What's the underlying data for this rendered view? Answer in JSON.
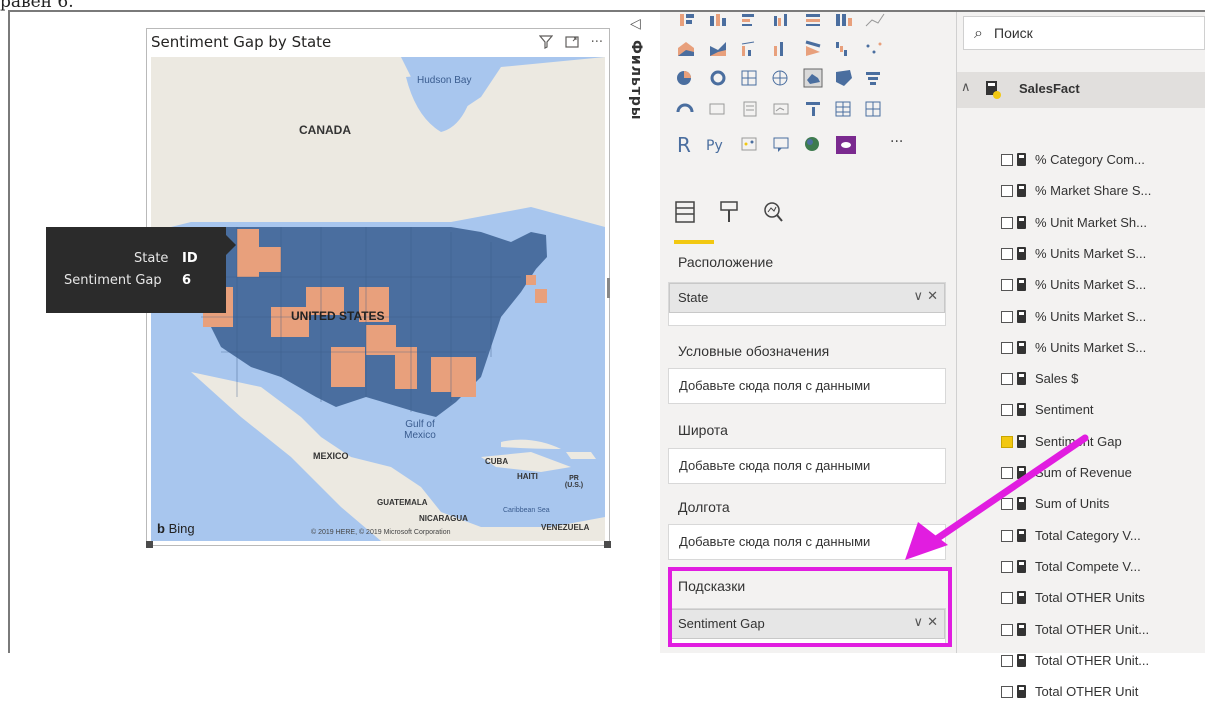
{
  "top_text": "равен 6.",
  "visual": {
    "title": "Sentiment Gap by State",
    "filter_icon": "funnel-icon",
    "focus_icon": "focus-mode-icon",
    "more_icon": "ellipsis-icon",
    "map_labels": {
      "hudson_bay": "Hudson Bay",
      "canada": "CANADA",
      "united_states": "UNITED STATES",
      "gulf": "Gulf of Mexico",
      "mexico": "MEXICO",
      "cuba": "CUBA",
      "haiti": "HAITI",
      "pr": "PR (U.S.)",
      "guatemala": "GUATEMALA",
      "nicaragua": "NICARAGUA",
      "caribbean": "Caribbean Sea",
      "venezuela": "VENEZUELA",
      "bing": "Bing",
      "copyright": "© 2019 HERE, © 2019 Microsoft Corporation"
    },
    "colors": {
      "high": "#4a6e9f",
      "low": "#e8a07c",
      "water": "#a8c6ee",
      "land": "#ece9e1"
    }
  },
  "tooltip": {
    "state_label": "State",
    "state_value": "ID",
    "gap_label": "Sentiment Gap",
    "gap_value": "6"
  },
  "filters_pane": {
    "collapse_icon": "chevron-left-icon",
    "label": "Фильтры"
  },
  "viz_pane": {
    "tabs": [
      "fields-icon",
      "format-paint-icon",
      "analytics-icon"
    ],
    "sections": {
      "location_label": "Расположение",
      "location_value": "State",
      "legend_label": "Условные обозначения",
      "legend_placeholder": "Добавьте сюда поля с данными",
      "lat_label": "Широта",
      "lat_placeholder": "Добавьте сюда поля с данными",
      "lon_label": "Долгота",
      "lon_placeholder": "Добавьте сюда поля с данными",
      "tooltips_label": "Подсказки",
      "tooltips_value": "Sentiment Gap"
    },
    "pill_controls": "∨ ✕",
    "more_visuals": "···"
  },
  "fields_pane": {
    "search_placeholder": "Поиск",
    "table_name": "SalesFact",
    "fields": [
      {
        "name": "% Category Com...",
        "checked": false
      },
      {
        "name": "% Market Share S...",
        "checked": false
      },
      {
        "name": "% Unit Market Sh...",
        "checked": false
      },
      {
        "name": "% Units Market S...",
        "checked": false
      },
      {
        "name": "% Units Market S...",
        "checked": false
      },
      {
        "name": "% Units Market S...",
        "checked": false
      },
      {
        "name": "% Units Market S...",
        "checked": false
      },
      {
        "name": "Sales $",
        "checked": false
      },
      {
        "name": "Sentiment",
        "checked": false
      },
      {
        "name": "Sentiment Gap",
        "checked": true
      },
      {
        "name": "Sum of Revenue",
        "checked": false
      },
      {
        "name": "Sum of Units",
        "checked": false
      },
      {
        "name": "Total Category V...",
        "checked": false
      },
      {
        "name": "Total Compete V...",
        "checked": false
      },
      {
        "name": "Total OTHER Units",
        "checked": false
      },
      {
        "name": "Total OTHER Unit...",
        "checked": false
      },
      {
        "name": "Total OTHER Unit...",
        "checked": false
      },
      {
        "name": "Total OTHER Unit",
        "checked": false
      }
    ]
  },
  "annotation": {
    "arrow_color": "#e11de0"
  }
}
